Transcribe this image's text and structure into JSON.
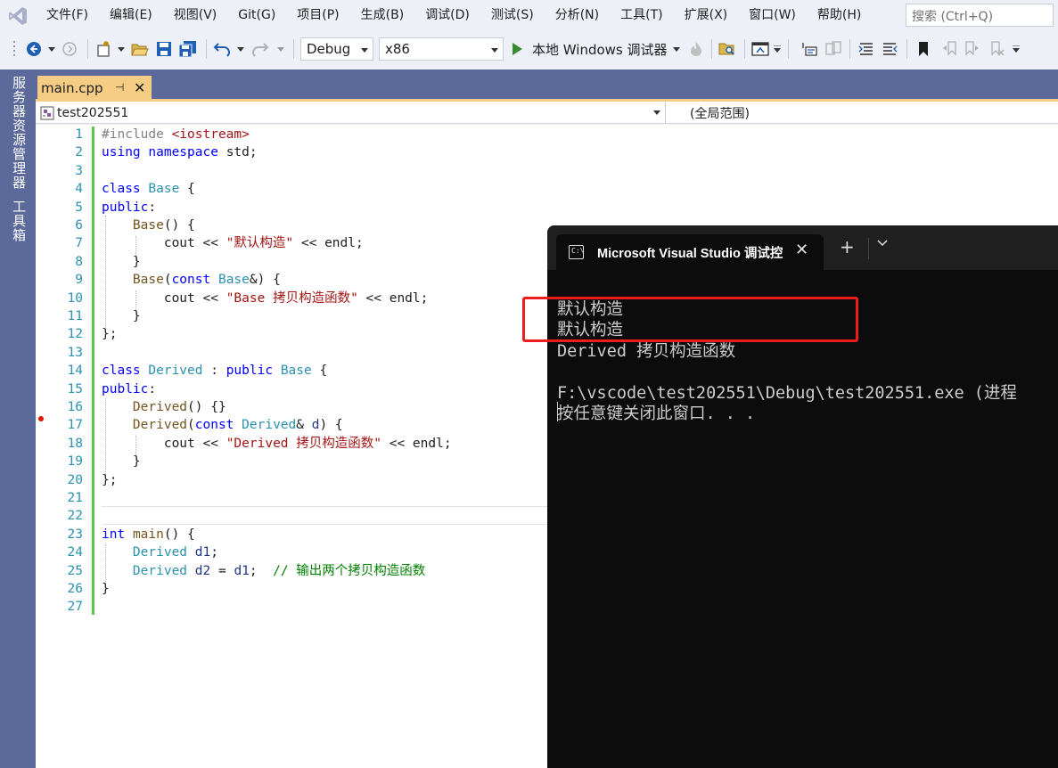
{
  "menu": {
    "items": [
      "文件(F)",
      "编辑(E)",
      "视图(V)",
      "Git(G)",
      "项目(P)",
      "生成(B)",
      "调试(D)",
      "测试(S)",
      "分析(N)",
      "工具(T)",
      "扩展(X)",
      "窗口(W)",
      "帮助(H)"
    ],
    "search_placeholder": "搜索 (Ctrl+Q)"
  },
  "toolbar": {
    "configuration": "Debug",
    "platform": "x86",
    "run_label": "本地 Windows 调试器"
  },
  "left_rail": {
    "tabs": [
      "服务器资源管理器",
      "工具箱"
    ]
  },
  "document_tab": {
    "filename": "main.cpp"
  },
  "navbar": {
    "project_scope": "test202551",
    "member_scope": "(全局范围)"
  },
  "code": {
    "line_numbers": [
      "1",
      "2",
      "3",
      "4",
      "5",
      "6",
      "7",
      "8",
      "9",
      "10",
      "11",
      "12",
      "13",
      "14",
      "15",
      "16",
      "17",
      "18",
      "19",
      "20",
      "21",
      "22",
      "23",
      "24",
      "25",
      "26",
      "27"
    ]
  },
  "console": {
    "tab_title": "Microsoft Visual Studio 调试控",
    "output_lines": [
      "默认构造",
      "默认构造",
      "Derived 拷贝构造函数",
      "",
      "F:\\vscode\\test202551\\Debug\\test202551.exe (进程",
      "按任意键关闭此窗口. . ."
    ]
  },
  "colors": {
    "accent_rail": "#5b6a9b",
    "tab_active": "#f5cc84",
    "highlight": "#ee1c1c",
    "console_bg": "#0c0c0c"
  }
}
